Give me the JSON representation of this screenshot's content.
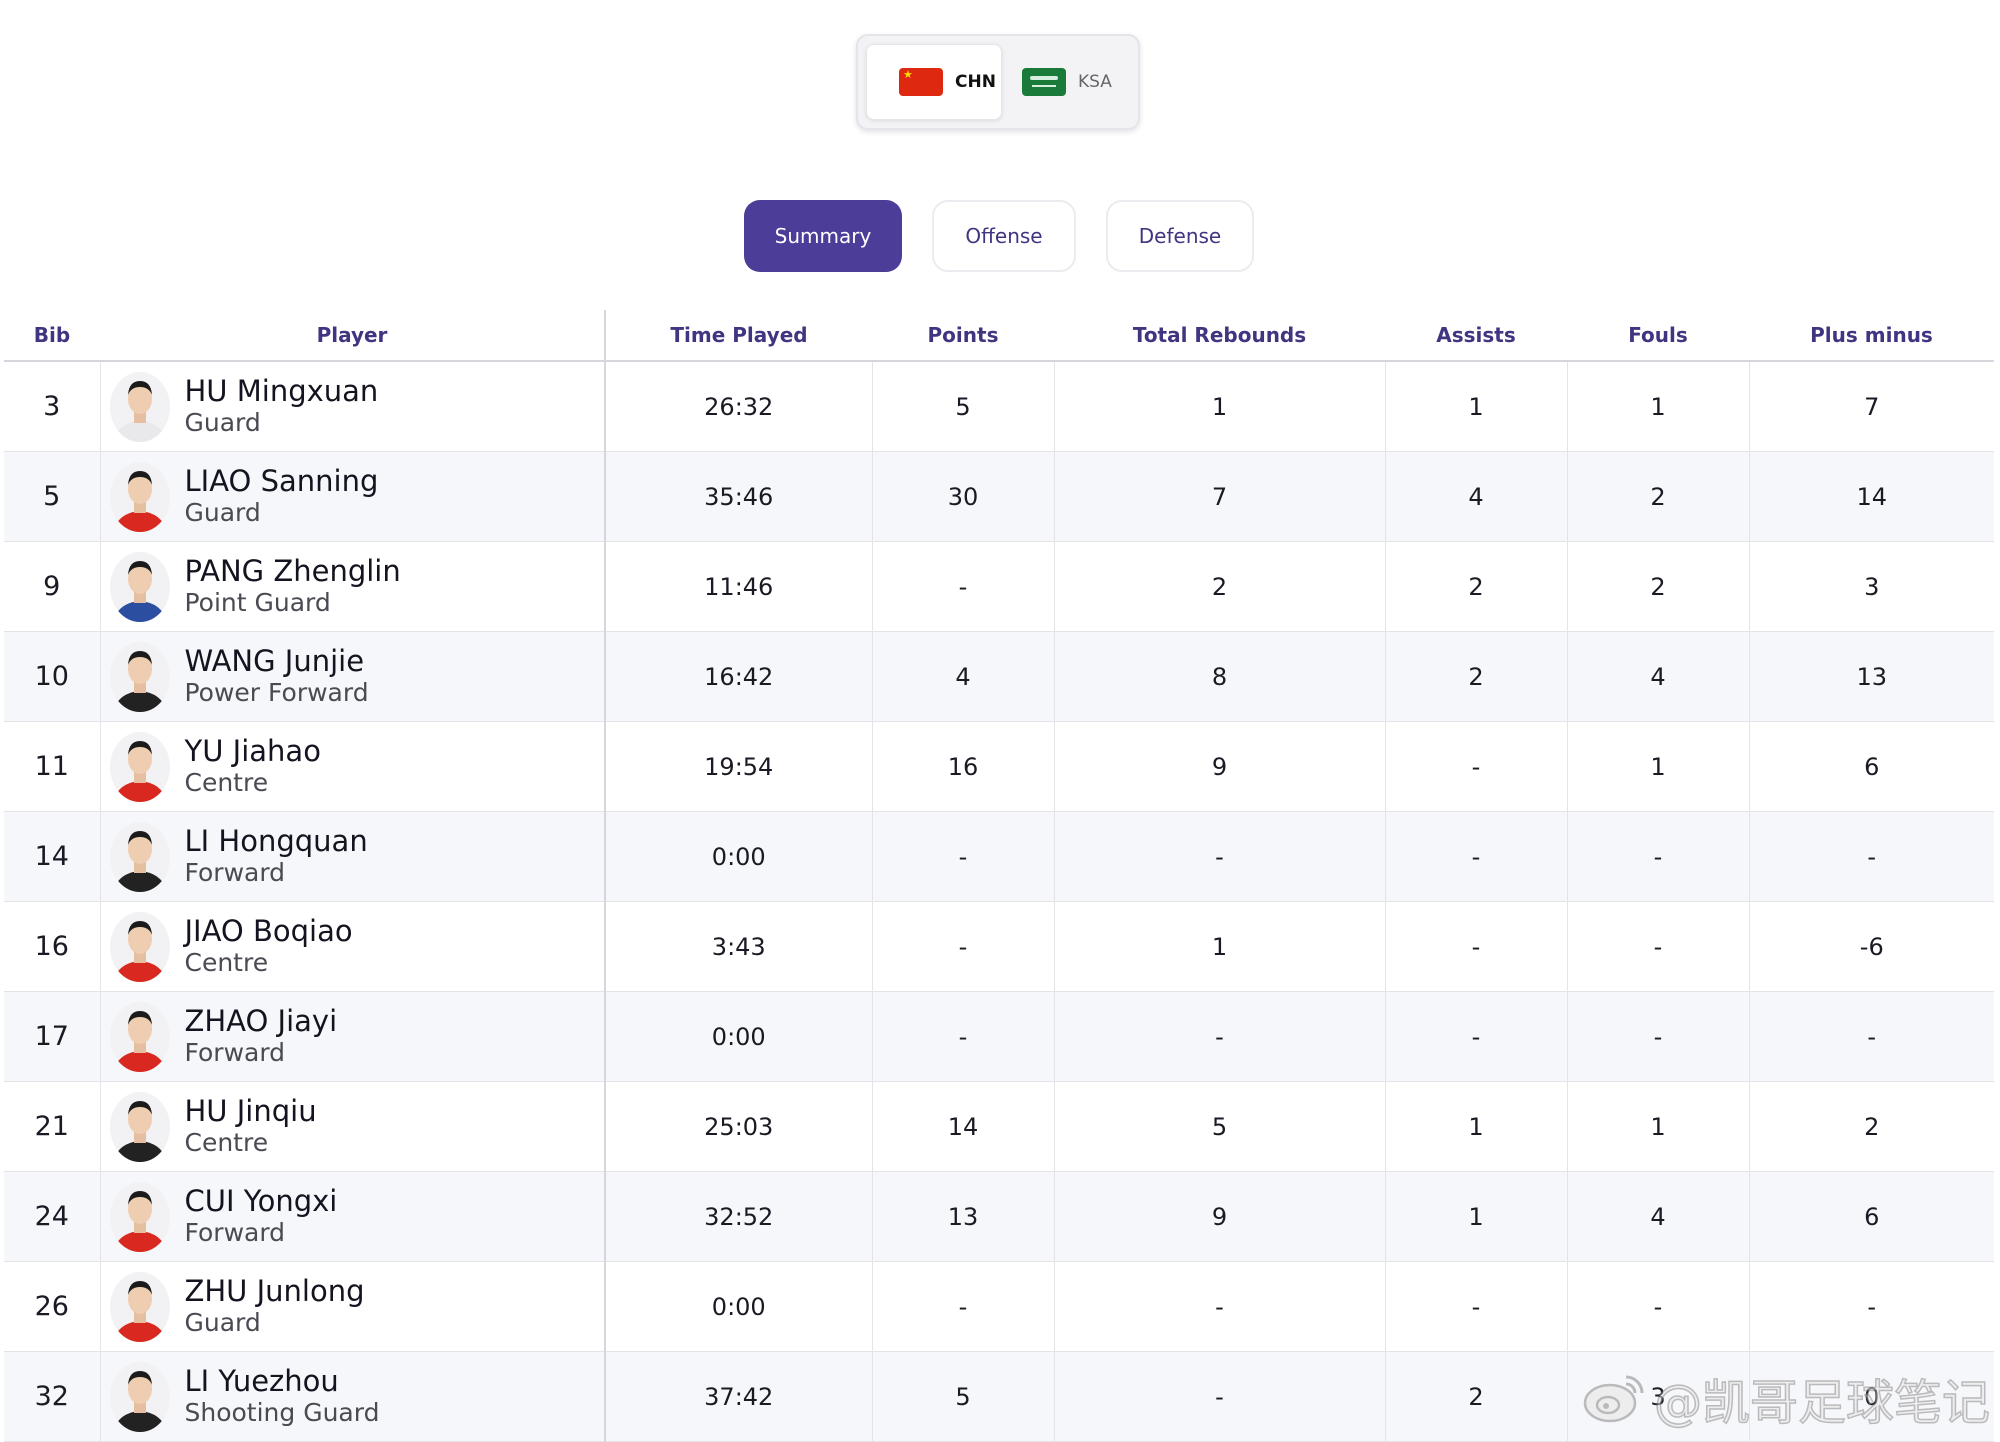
{
  "teams": {
    "active": {
      "code": "CHN",
      "flag_icon": "china-flag-icon"
    },
    "inactive": {
      "code": "KSA",
      "flag_icon": "saudi-arabia-flag-icon"
    }
  },
  "tabs": [
    {
      "label": "Summary",
      "active": true
    },
    {
      "label": "Offense",
      "active": false
    },
    {
      "label": "Defense",
      "active": false
    }
  ],
  "colors": {
    "accent": "#4b3d98",
    "header_text": "#3f3580",
    "row_alt": "#f6f7fa",
    "jersey_red": "#d8281f",
    "jersey_blue": "#2c4ea0",
    "jersey_black": "#222222",
    "jersey_white": "#e9e9ec"
  },
  "table": {
    "headers": {
      "bib": "Bib",
      "player": "Player",
      "time_played": "Time Played",
      "points": "Points",
      "total_rebounds": "Total Rebounds",
      "assists": "Assists",
      "fouls": "Fouls",
      "plus_minus": "Plus minus"
    },
    "rows": [
      {
        "bib": "3",
        "name": "HU Mingxuan",
        "position": "Guard",
        "time": "26:32",
        "points": "5",
        "rebounds": "1",
        "assists": "1",
        "fouls": "1",
        "plus_minus": "7",
        "jersey": "white"
      },
      {
        "bib": "5",
        "name": "LIAO Sanning",
        "position": "Guard",
        "time": "35:46",
        "points": "30",
        "rebounds": "7",
        "assists": "4",
        "fouls": "2",
        "plus_minus": "14",
        "jersey": "red"
      },
      {
        "bib": "9",
        "name": "PANG Zhenglin",
        "position": "Point Guard",
        "time": "11:46",
        "points": "-",
        "rebounds": "2",
        "assists": "2",
        "fouls": "2",
        "plus_minus": "3",
        "jersey": "blue"
      },
      {
        "bib": "10",
        "name": "WANG Junjie",
        "position": "Power Forward",
        "time": "16:42",
        "points": "4",
        "rebounds": "8",
        "assists": "2",
        "fouls": "4",
        "plus_minus": "13",
        "jersey": "black"
      },
      {
        "bib": "11",
        "name": "YU Jiahao",
        "position": "Centre",
        "time": "19:54",
        "points": "16",
        "rebounds": "9",
        "assists": "-",
        "fouls": "1",
        "plus_minus": "6",
        "jersey": "red"
      },
      {
        "bib": "14",
        "name": "LI Hongquan",
        "position": "Forward",
        "time": "0:00",
        "points": "-",
        "rebounds": "-",
        "assists": "-",
        "fouls": "-",
        "plus_minus": "-",
        "jersey": "black"
      },
      {
        "bib": "16",
        "name": "JIAO Boqiao",
        "position": "Centre",
        "time": "3:43",
        "points": "-",
        "rebounds": "1",
        "assists": "-",
        "fouls": "-",
        "plus_minus": "-6",
        "jersey": "red"
      },
      {
        "bib": "17",
        "name": "ZHAO Jiayi",
        "position": "Forward",
        "time": "0:00",
        "points": "-",
        "rebounds": "-",
        "assists": "-",
        "fouls": "-",
        "plus_minus": "-",
        "jersey": "red"
      },
      {
        "bib": "21",
        "name": "HU Jinqiu",
        "position": "Centre",
        "time": "25:03",
        "points": "14",
        "rebounds": "5",
        "assists": "1",
        "fouls": "1",
        "plus_minus": "2",
        "jersey": "black"
      },
      {
        "bib": "24",
        "name": "CUI Yongxi",
        "position": "Forward",
        "time": "32:52",
        "points": "13",
        "rebounds": "9",
        "assists": "1",
        "fouls": "4",
        "plus_minus": "6",
        "jersey": "red"
      },
      {
        "bib": "26",
        "name": "ZHU Junlong",
        "position": "Guard",
        "time": "0:00",
        "points": "-",
        "rebounds": "-",
        "assists": "-",
        "fouls": "-",
        "plus_minus": "-",
        "jersey": "red"
      },
      {
        "bib": "32",
        "name": "LI Yuezhou",
        "position": "Shooting Guard",
        "time": "37:42",
        "points": "5",
        "rebounds": "-",
        "assists": "2",
        "fouls": "3",
        "plus_minus": "0",
        "jersey": "black"
      }
    ]
  },
  "watermark": {
    "text": "@凯哥足球笔记",
    "icon": "weibo-logo-icon"
  }
}
